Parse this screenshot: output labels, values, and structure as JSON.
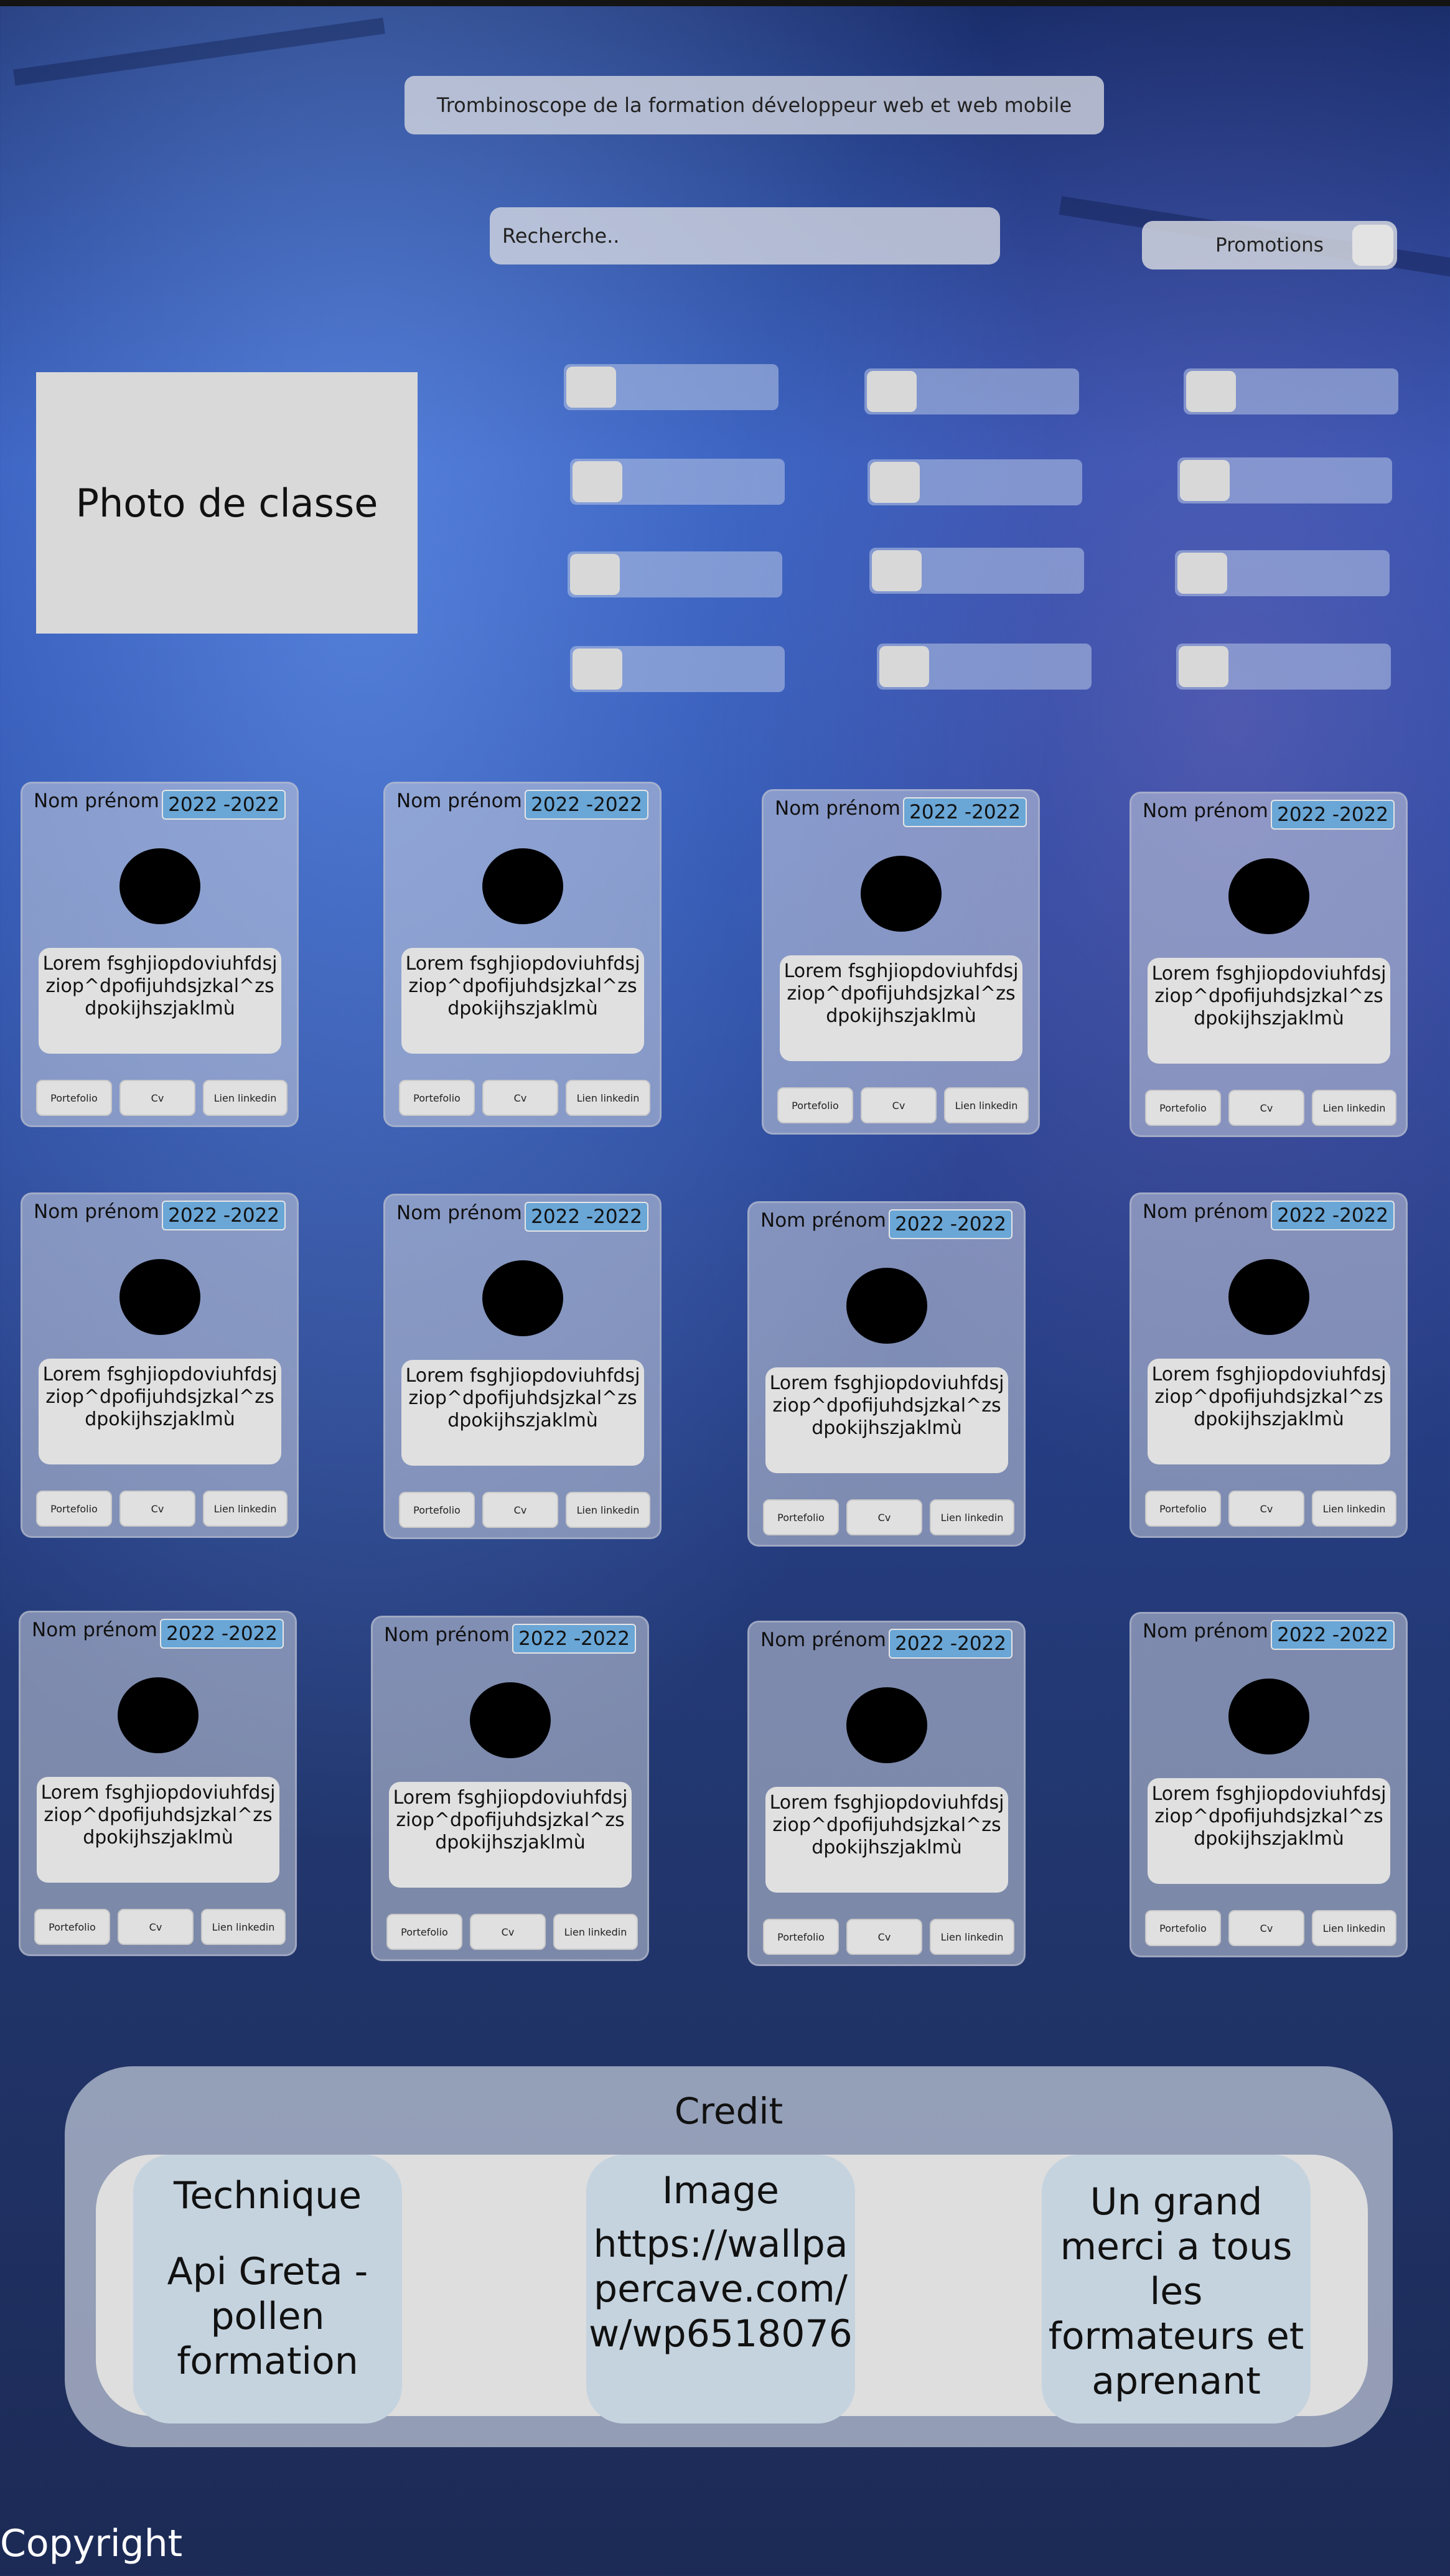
{
  "header": {
    "title": "Trombinoscope de la formation développeur web et web mobile",
    "search_placeholder": "Recherche..",
    "promotions_label": "Promotions"
  },
  "class_photo": "Photo de classe",
  "filters_count": 12,
  "cards": [
    {
      "name": "Nom prénom",
      "dates": "2022 -2022",
      "desc": "Lorem fsghjiopdoviuhfdsjziop^dpofijuhdsjzkal^zsdpokijhszjaklmù",
      "portfolio": "Portefolio",
      "cv": "Cv",
      "linkedin": "Lien linkedin"
    },
    {
      "name": "Nom prénom",
      "dates": "2022 -2022",
      "desc": "Lorem fsghjiopdoviuhfdsjziop^dpofijuhdsjzkal^zsdpokijhszjaklmù",
      "portfolio": "Portefolio",
      "cv": "Cv",
      "linkedin": "Lien linkedin"
    },
    {
      "name": "Nom prénom",
      "dates": "2022 -2022",
      "desc": "Lorem fsghjiopdoviuhfdsjziop^dpofijuhdsjzkal^zsdpokijhszjaklmù",
      "portfolio": "Portefolio",
      "cv": "Cv",
      "linkedin": "Lien linkedin"
    },
    {
      "name": "Nom prénom",
      "dates": "2022 -2022",
      "desc": "Lorem fsghjiopdoviuhfdsjziop^dpofijuhdsjzkal^zsdpokijhszjaklmù",
      "portfolio": "Portefolio",
      "cv": "Cv",
      "linkedin": "Lien linkedin"
    },
    {
      "name": "Nom prénom",
      "dates": "2022 -2022",
      "desc": "Lorem fsghjiopdoviuhfdsjziop^dpofijuhdsjzkal^zsdpokijhszjaklmù",
      "portfolio": "Portefolio",
      "cv": "Cv",
      "linkedin": "Lien linkedin"
    },
    {
      "name": "Nom prénom",
      "dates": "2022 -2022",
      "desc": "Lorem fsghjiopdoviuhfdsjziop^dpofijuhdsjzkal^zsdpokijhszjaklmù",
      "portfolio": "Portefolio",
      "cv": "Cv",
      "linkedin": "Lien linkedin"
    },
    {
      "name": "Nom prénom",
      "dates": "2022 -2022",
      "desc": "Lorem fsghjiopdoviuhfdsjziop^dpofijuhdsjzkal^zsdpokijhszjaklmù",
      "portfolio": "Portefolio",
      "cv": "Cv",
      "linkedin": "Lien linkedin"
    },
    {
      "name": "Nom prénom",
      "dates": "2022 -2022",
      "desc": "Lorem fsghjiopdoviuhfdsjziop^dpofijuhdsjzkal^zsdpokijhszjaklmù",
      "portfolio": "Portefolio",
      "cv": "Cv",
      "linkedin": "Lien linkedin"
    },
    {
      "name": "Nom prénom",
      "dates": "2022 -2022",
      "desc": "Lorem fsghjiopdoviuhfdsjziop^dpofijuhdsjzkal^zsdpokijhszjaklmù",
      "portfolio": "Portefolio",
      "cv": "Cv",
      "linkedin": "Lien linkedin"
    },
    {
      "name": "Nom prénom",
      "dates": "2022 -2022",
      "desc": "Lorem fsghjiopdoviuhfdsjziop^dpofijuhdsjzkal^zsdpokijhszjaklmù",
      "portfolio": "Portefolio",
      "cv": "Cv",
      "linkedin": "Lien linkedin"
    },
    {
      "name": "Nom prénom",
      "dates": "2022 -2022",
      "desc": "Lorem fsghjiopdoviuhfdsjziop^dpofijuhdsjzkal^zsdpokijhszjaklmù",
      "portfolio": "Portefolio",
      "cv": "Cv",
      "linkedin": "Lien linkedin"
    },
    {
      "name": "Nom prénom",
      "dates": "2022 -2022",
      "desc": "Lorem fsghjiopdoviuhfdsjziop^dpofijuhdsjzkal^zsdpokijhszjaklmù",
      "portfolio": "Portefolio",
      "cv": "Cv",
      "linkedin": "Lien linkedin"
    }
  ],
  "credit": {
    "title": "Credit",
    "technique_heading": "Technique",
    "technique_text": "Api Greta - pollen formation",
    "image_heading": "Image",
    "image_text": "https://wallpapercave.com/w/wp6518076",
    "thanks_text": "Un grand merci a tous les formateurs et aprenant"
  },
  "footer": {
    "copyright": "Copyright"
  },
  "colors": {
    "date_badge": "#6aa6d6",
    "panel": "#d9d9d9",
    "credit_column": "#c5d3df"
  }
}
